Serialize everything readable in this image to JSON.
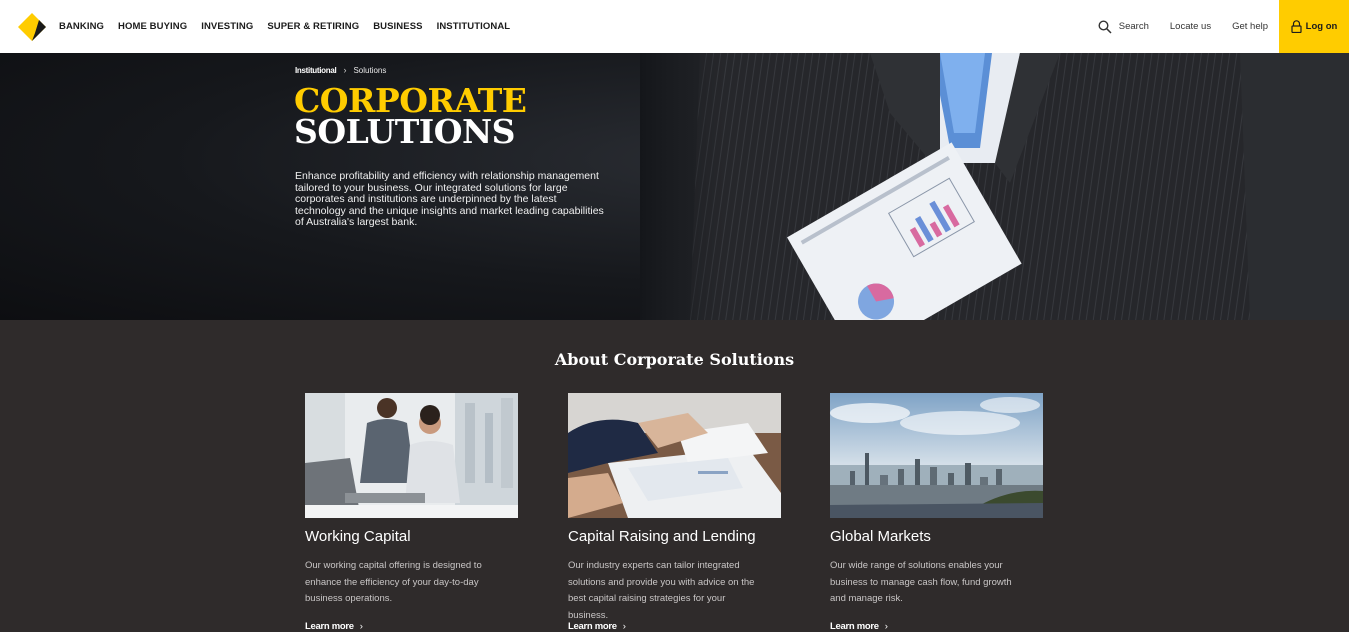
{
  "header": {
    "nav": [
      {
        "label": "BANKING"
      },
      {
        "label": "HOME BUYING"
      },
      {
        "label": "INVESTING"
      },
      {
        "label": "SUPER & RETIRING"
      },
      {
        "label": "BUSINESS"
      },
      {
        "label": "INSTITUTIONAL"
      }
    ],
    "search_label": "Search",
    "locate_label": "Locate us",
    "help_label": "Get help",
    "logon_label": "Log on"
  },
  "hero": {
    "breadcrumb": {
      "parent": "Institutional",
      "separator": "›",
      "current": "Solutions"
    },
    "title_line1": "CORPORATE",
    "title_line2": "SOLUTIONS",
    "description": "Enhance profitability and efficiency with relationship management tailored to your business. Our integrated solutions for large corporates and institutions are underpinned by the latest technology and the unique insights and market leading capabilities of Australia's largest bank."
  },
  "about": {
    "title": "About Corporate Solutions",
    "cards": [
      {
        "title": "Working Capital",
        "body": "Our working capital offering is designed to enhance the efficiency of your day-to-day business operations.",
        "link": "Learn more"
      },
      {
        "title": "Capital Raising and Lending",
        "body": "Our industry experts can tailor integrated solutions and provide you with advice on the best capital raising strategies for your business.",
        "link": "Learn more"
      },
      {
        "title": "Global Markets",
        "body": "Our wide range of solutions enables your business to manage cash flow, fund growth and manage risk.",
        "link": "Learn more"
      }
    ]
  },
  "colors": {
    "brand_yellow": "#ffcc00",
    "section_bg": "#2f2b2b",
    "header_bg": "#ffffff"
  },
  "icons": [
    "brand-diamond-logo",
    "search-icon",
    "lock-icon",
    "chevron-right-icon"
  ]
}
